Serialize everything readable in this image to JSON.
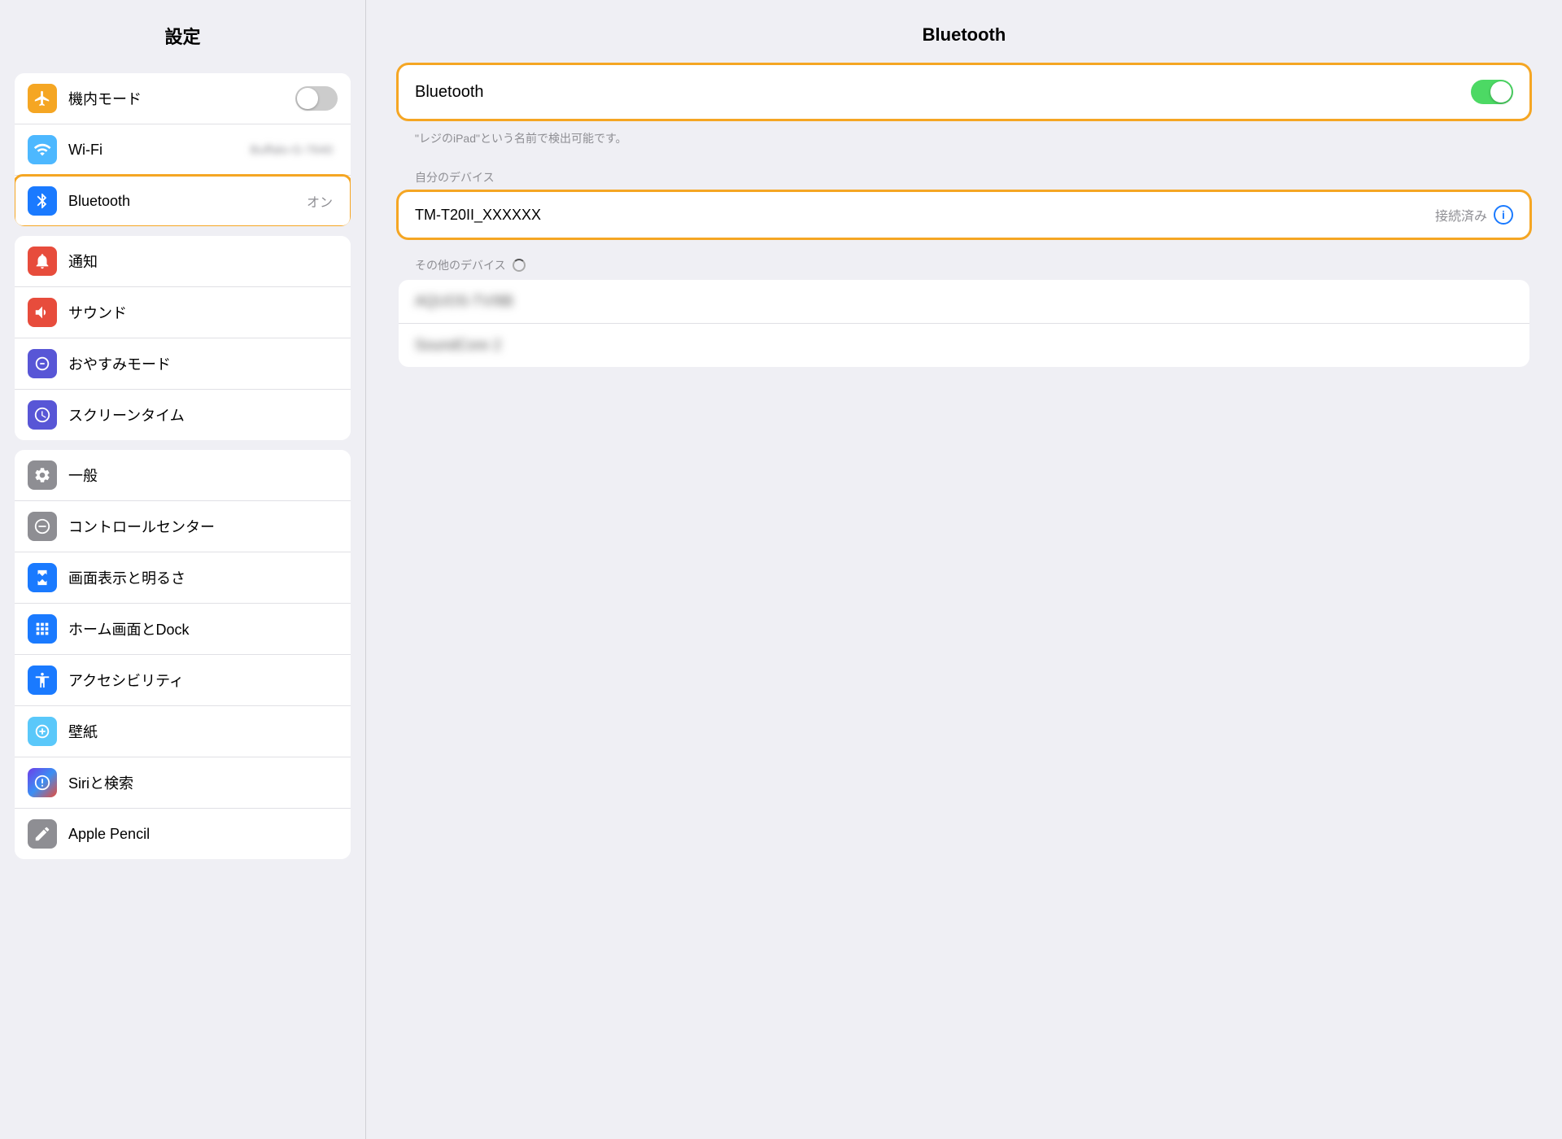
{
  "sidebar": {
    "title": "設定",
    "groups": [
      {
        "id": "group1",
        "items": [
          {
            "id": "airplane",
            "label": "機内モード",
            "icon": "airplane",
            "valueType": "toggle",
            "toggleOn": false
          },
          {
            "id": "wifi",
            "label": "Wi-Fi",
            "icon": "wifi",
            "valueType": "text",
            "value": "Buffalo-G-7640"
          },
          {
            "id": "bluetooth",
            "label": "Bluetooth",
            "icon": "bluetooth",
            "valueType": "text",
            "value": "オン",
            "active": true
          }
        ]
      },
      {
        "id": "group2",
        "items": [
          {
            "id": "notification",
            "label": "通知",
            "icon": "notification"
          },
          {
            "id": "sound",
            "label": "サウンド",
            "icon": "sound"
          },
          {
            "id": "donotdisturb",
            "label": "おやすみモード",
            "icon": "donotdisturb"
          },
          {
            "id": "screentime",
            "label": "スクリーンタイム",
            "icon": "screentime"
          }
        ]
      },
      {
        "id": "group3",
        "items": [
          {
            "id": "general",
            "label": "一般",
            "icon": "general"
          },
          {
            "id": "controlcenter",
            "label": "コントロールセンター",
            "icon": "controlcenter"
          },
          {
            "id": "display",
            "label": "画面表示と明るさ",
            "icon": "display"
          },
          {
            "id": "homescreen",
            "label": "ホーム画面とDock",
            "icon": "homescreen"
          },
          {
            "id": "accessibility",
            "label": "アクセシビリティ",
            "icon": "accessibility"
          },
          {
            "id": "wallpaper",
            "label": "壁紙",
            "icon": "wallpaper"
          },
          {
            "id": "siri",
            "label": "Siriと検索",
            "icon": "siri"
          },
          {
            "id": "applepencil",
            "label": "Apple Pencil",
            "icon": "applepencil"
          }
        ]
      }
    ]
  },
  "main": {
    "title": "Bluetooth",
    "bluetooth_label": "Bluetooth",
    "discoverable_note": "\"レジのiPad\"という名前で検出可能です。",
    "my_devices_label": "自分のデバイス",
    "other_devices_label": "その他のデバイス",
    "connected_device": {
      "name": "TM-T20II_XXXXXX",
      "status": "接続済み"
    },
    "other_devices": [
      {
        "name": "AQUOS-TV/8B"
      },
      {
        "name": "SoundCore 2"
      }
    ]
  }
}
